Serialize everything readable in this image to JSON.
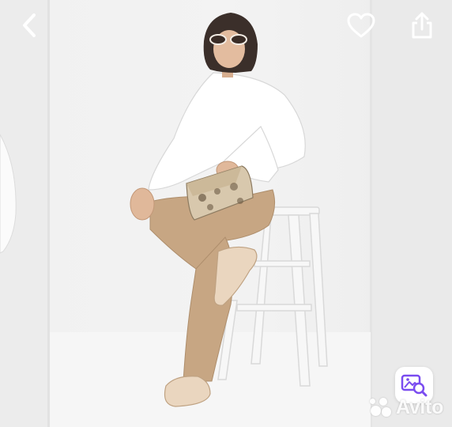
{
  "photo": {
    "description_name": "product-photo"
  },
  "toolbar": {
    "back_icon": "chevron-left-icon",
    "favorite_icon": "heart-icon",
    "share_icon": "share-icon"
  },
  "search_by_photo": {
    "icon": "image-search-icon",
    "accent": "#7a4cf0"
  },
  "watermark": {
    "text": "Avito"
  },
  "colors": {
    "background": "#f1f1f1",
    "icon": "#ffffff"
  }
}
